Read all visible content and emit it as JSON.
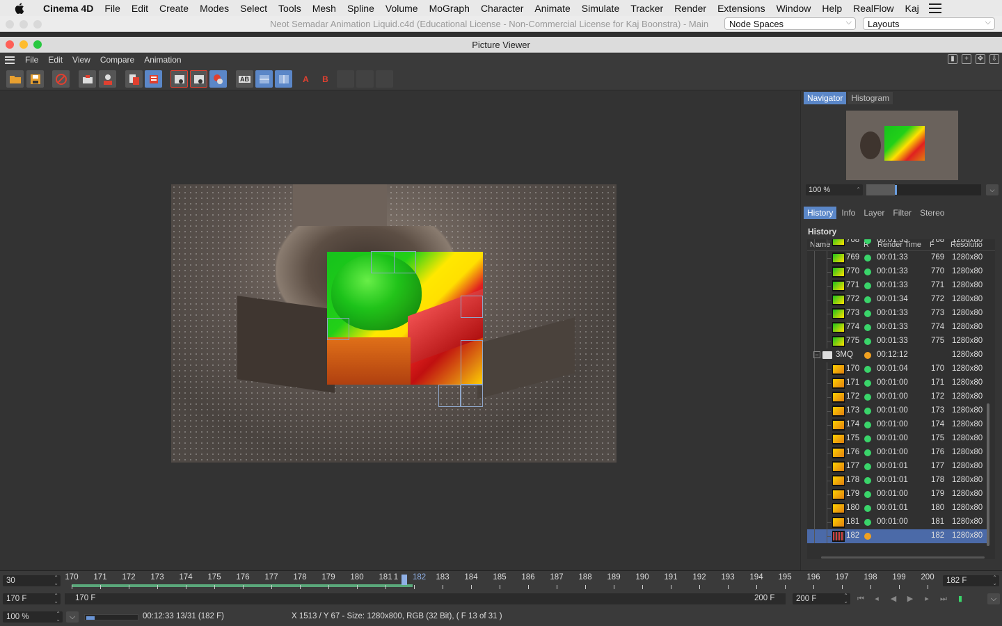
{
  "mac_menu": {
    "app_name": "Cinema 4D",
    "items": [
      "File",
      "Edit",
      "Create",
      "Modes",
      "Select",
      "Tools",
      "Mesh",
      "Spline",
      "Volume",
      "MoGraph",
      "Character",
      "Animate",
      "Simulate",
      "Tracker",
      "Render",
      "Extensions",
      "Window",
      "Help",
      "RealFlow",
      "Kaj"
    ]
  },
  "main_window": {
    "title": "Neot Semadar Animation Liquid.c4d (Educational License - Non-Commercial License for Kaj Boonstra) - Main",
    "node_spaces": "Node Spaces",
    "layouts": "Layouts"
  },
  "picture_viewer": {
    "title": "Picture Viewer",
    "menu": [
      "File",
      "Edit",
      "View",
      "Compare",
      "Animation"
    ]
  },
  "navigator": {
    "tabs": [
      "Navigator",
      "Histogram"
    ],
    "zoom": "100 %",
    "zoom_level": 0.25
  },
  "history": {
    "tabs": [
      "History",
      "Info",
      "Layer",
      "Filter",
      "Stereo"
    ],
    "label": "History",
    "columns": {
      "name": "Name",
      "r": "R",
      "render_time": "Render Time",
      "f": "F",
      "resolution": "Resolutio"
    },
    "partial_row": {
      "name": "768",
      "time": "00:01:33",
      "f": "768",
      "res": "1280x80"
    },
    "rows_a": [
      {
        "name": "769",
        "time": "00:01:33",
        "f": "769",
        "res": "1280x80"
      },
      {
        "name": "770",
        "time": "00:01:33",
        "f": "770",
        "res": "1280x80"
      },
      {
        "name": "771",
        "time": "00:01:33",
        "f": "771",
        "res": "1280x80"
      },
      {
        "name": "772",
        "time": "00:01:34",
        "f": "772",
        "res": "1280x80"
      },
      {
        "name": "773",
        "time": "00:01:33",
        "f": "773",
        "res": "1280x80"
      },
      {
        "name": "774",
        "time": "00:01:33",
        "f": "774",
        "res": "1280x80"
      },
      {
        "name": "775",
        "time": "00:01:33",
        "f": "775",
        "res": "1280x80"
      }
    ],
    "folder": {
      "name": "3MQ",
      "time": "00:12:12",
      "res": "1280x80"
    },
    "rows_b": [
      {
        "name": "170",
        "time": "00:01:04",
        "f": "170",
        "res": "1280x80"
      },
      {
        "name": "171",
        "time": "00:01:00",
        "f": "171",
        "res": "1280x80"
      },
      {
        "name": "172",
        "time": "00:01:00",
        "f": "172",
        "res": "1280x80"
      },
      {
        "name": "173",
        "time": "00:01:00",
        "f": "173",
        "res": "1280x80"
      },
      {
        "name": "174",
        "time": "00:01:00",
        "f": "174",
        "res": "1280x80"
      },
      {
        "name": "175",
        "time": "00:01:00",
        "f": "175",
        "res": "1280x80"
      },
      {
        "name": "176",
        "time": "00:01:00",
        "f": "176",
        "res": "1280x80"
      },
      {
        "name": "177",
        "time": "00:01:01",
        "f": "177",
        "res": "1280x80"
      },
      {
        "name": "178",
        "time": "00:01:01",
        "f": "178",
        "res": "1280x80"
      },
      {
        "name": "179",
        "time": "00:01:00",
        "f": "179",
        "res": "1280x80"
      },
      {
        "name": "180",
        "time": "00:01:01",
        "f": "180",
        "res": "1280x80"
      },
      {
        "name": "181",
        "time": "00:01:00",
        "f": "181",
        "res": "1280x80"
      }
    ],
    "current_row": {
      "name": "182",
      "time": "",
      "f": "182",
      "res": "1280x80"
    }
  },
  "timeline": {
    "fps": "30",
    "start_frame": "170 F",
    "range_start": "170 F",
    "range_end_label": "200 F",
    "end_frame": "200 F",
    "current_frame": "182 F",
    "zoom": "100 %",
    "ruler_labels": [
      "170",
      "171",
      "172",
      "173",
      "174",
      "175",
      "176",
      "177",
      "178",
      "179",
      "180",
      "181",
      "1",
      "182",
      "183",
      "184",
      "185",
      "186",
      "187",
      "188",
      "189",
      "190",
      "191",
      "192",
      "193",
      "194",
      "195",
      "196",
      "197",
      "198",
      "199",
      "200"
    ],
    "render_progress": 0.16,
    "status_time": "00:12:33 13/31 (182 F)",
    "status_info": "X 1513 / Y 67 - Size: 1280x800, RGB (32 Bit),  ( F 13 of 31 )"
  }
}
